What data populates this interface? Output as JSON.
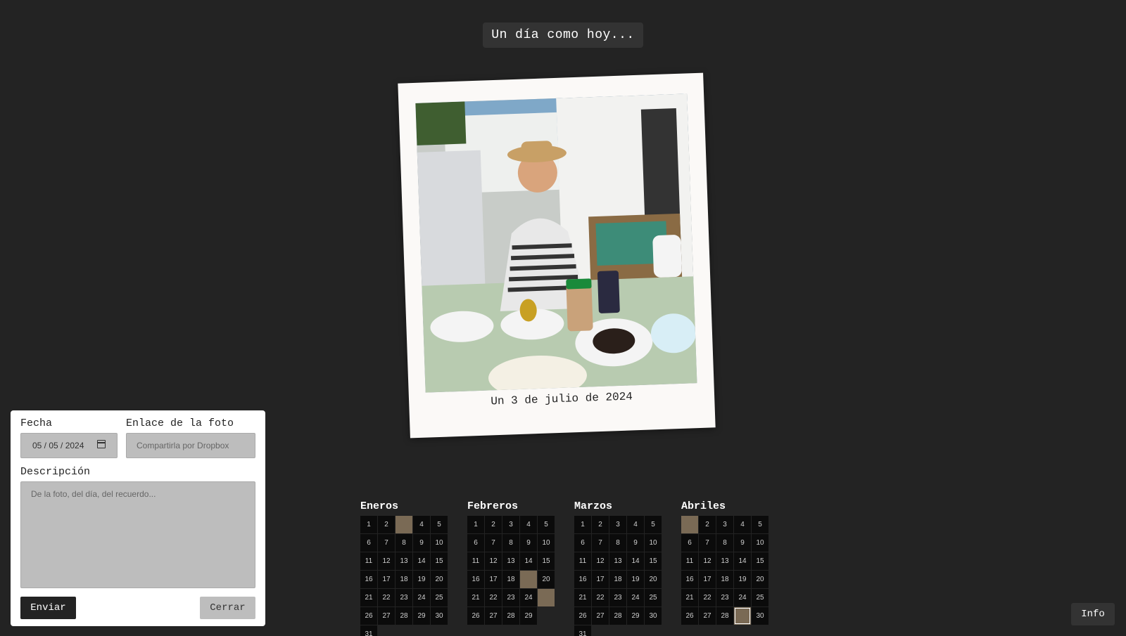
{
  "header": {
    "title": "Un día como hoy..."
  },
  "polaroid": {
    "caption": "Un 3 de julio de 2024"
  },
  "form": {
    "date_label": "Fecha",
    "date_value": "05 / 05 / 2024",
    "link_label": "Enlace de la foto",
    "link_placeholder": "Compartirla por Dropbox",
    "description_label": "Descripción",
    "description_placeholder": "De la foto, del día, del recuerdo...",
    "send_label": "Enviar",
    "close_label": "Cerrar"
  },
  "months": [
    {
      "name": "Eneros",
      "days": 31,
      "photo_days": [
        3
      ]
    },
    {
      "name": "Febreros",
      "days": 29,
      "photo_days": [
        19,
        25
      ]
    },
    {
      "name": "Marzos",
      "days": 31,
      "photo_days": []
    },
    {
      "name": "Abriles",
      "days": 30,
      "photo_days": [
        1,
        29
      ]
    }
  ],
  "info_label": "Info",
  "colors": {
    "background": "#232323",
    "polaroid": "#fbf9f7",
    "cell": "#0b0b0b",
    "field": "#bdbdbd"
  }
}
